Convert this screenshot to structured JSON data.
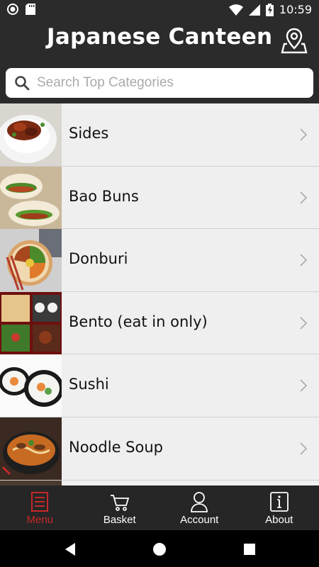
{
  "status_bar": {
    "time": "10:59"
  },
  "header": {
    "title": "Japanese Canteen"
  },
  "search": {
    "placeholder": "Search Top Categories"
  },
  "categories": [
    {
      "label": "Sides"
    },
    {
      "label": "Bao Buns"
    },
    {
      "label": "Donburi"
    },
    {
      "label": "Bento (eat in only)"
    },
    {
      "label": "Sushi"
    },
    {
      "label": "Noodle Soup"
    }
  ],
  "tabs": [
    {
      "label": "Menu",
      "icon": "menu-list-icon",
      "active": true
    },
    {
      "label": "Basket",
      "icon": "cart-icon",
      "active": false
    },
    {
      "label": "Account",
      "icon": "person-icon",
      "active": false
    },
    {
      "label": "About",
      "icon": "info-icon",
      "active": false
    }
  ],
  "colors": {
    "accent": "#c62828",
    "header_bg": "#2b2b2b",
    "list_bg": "#efefef"
  }
}
